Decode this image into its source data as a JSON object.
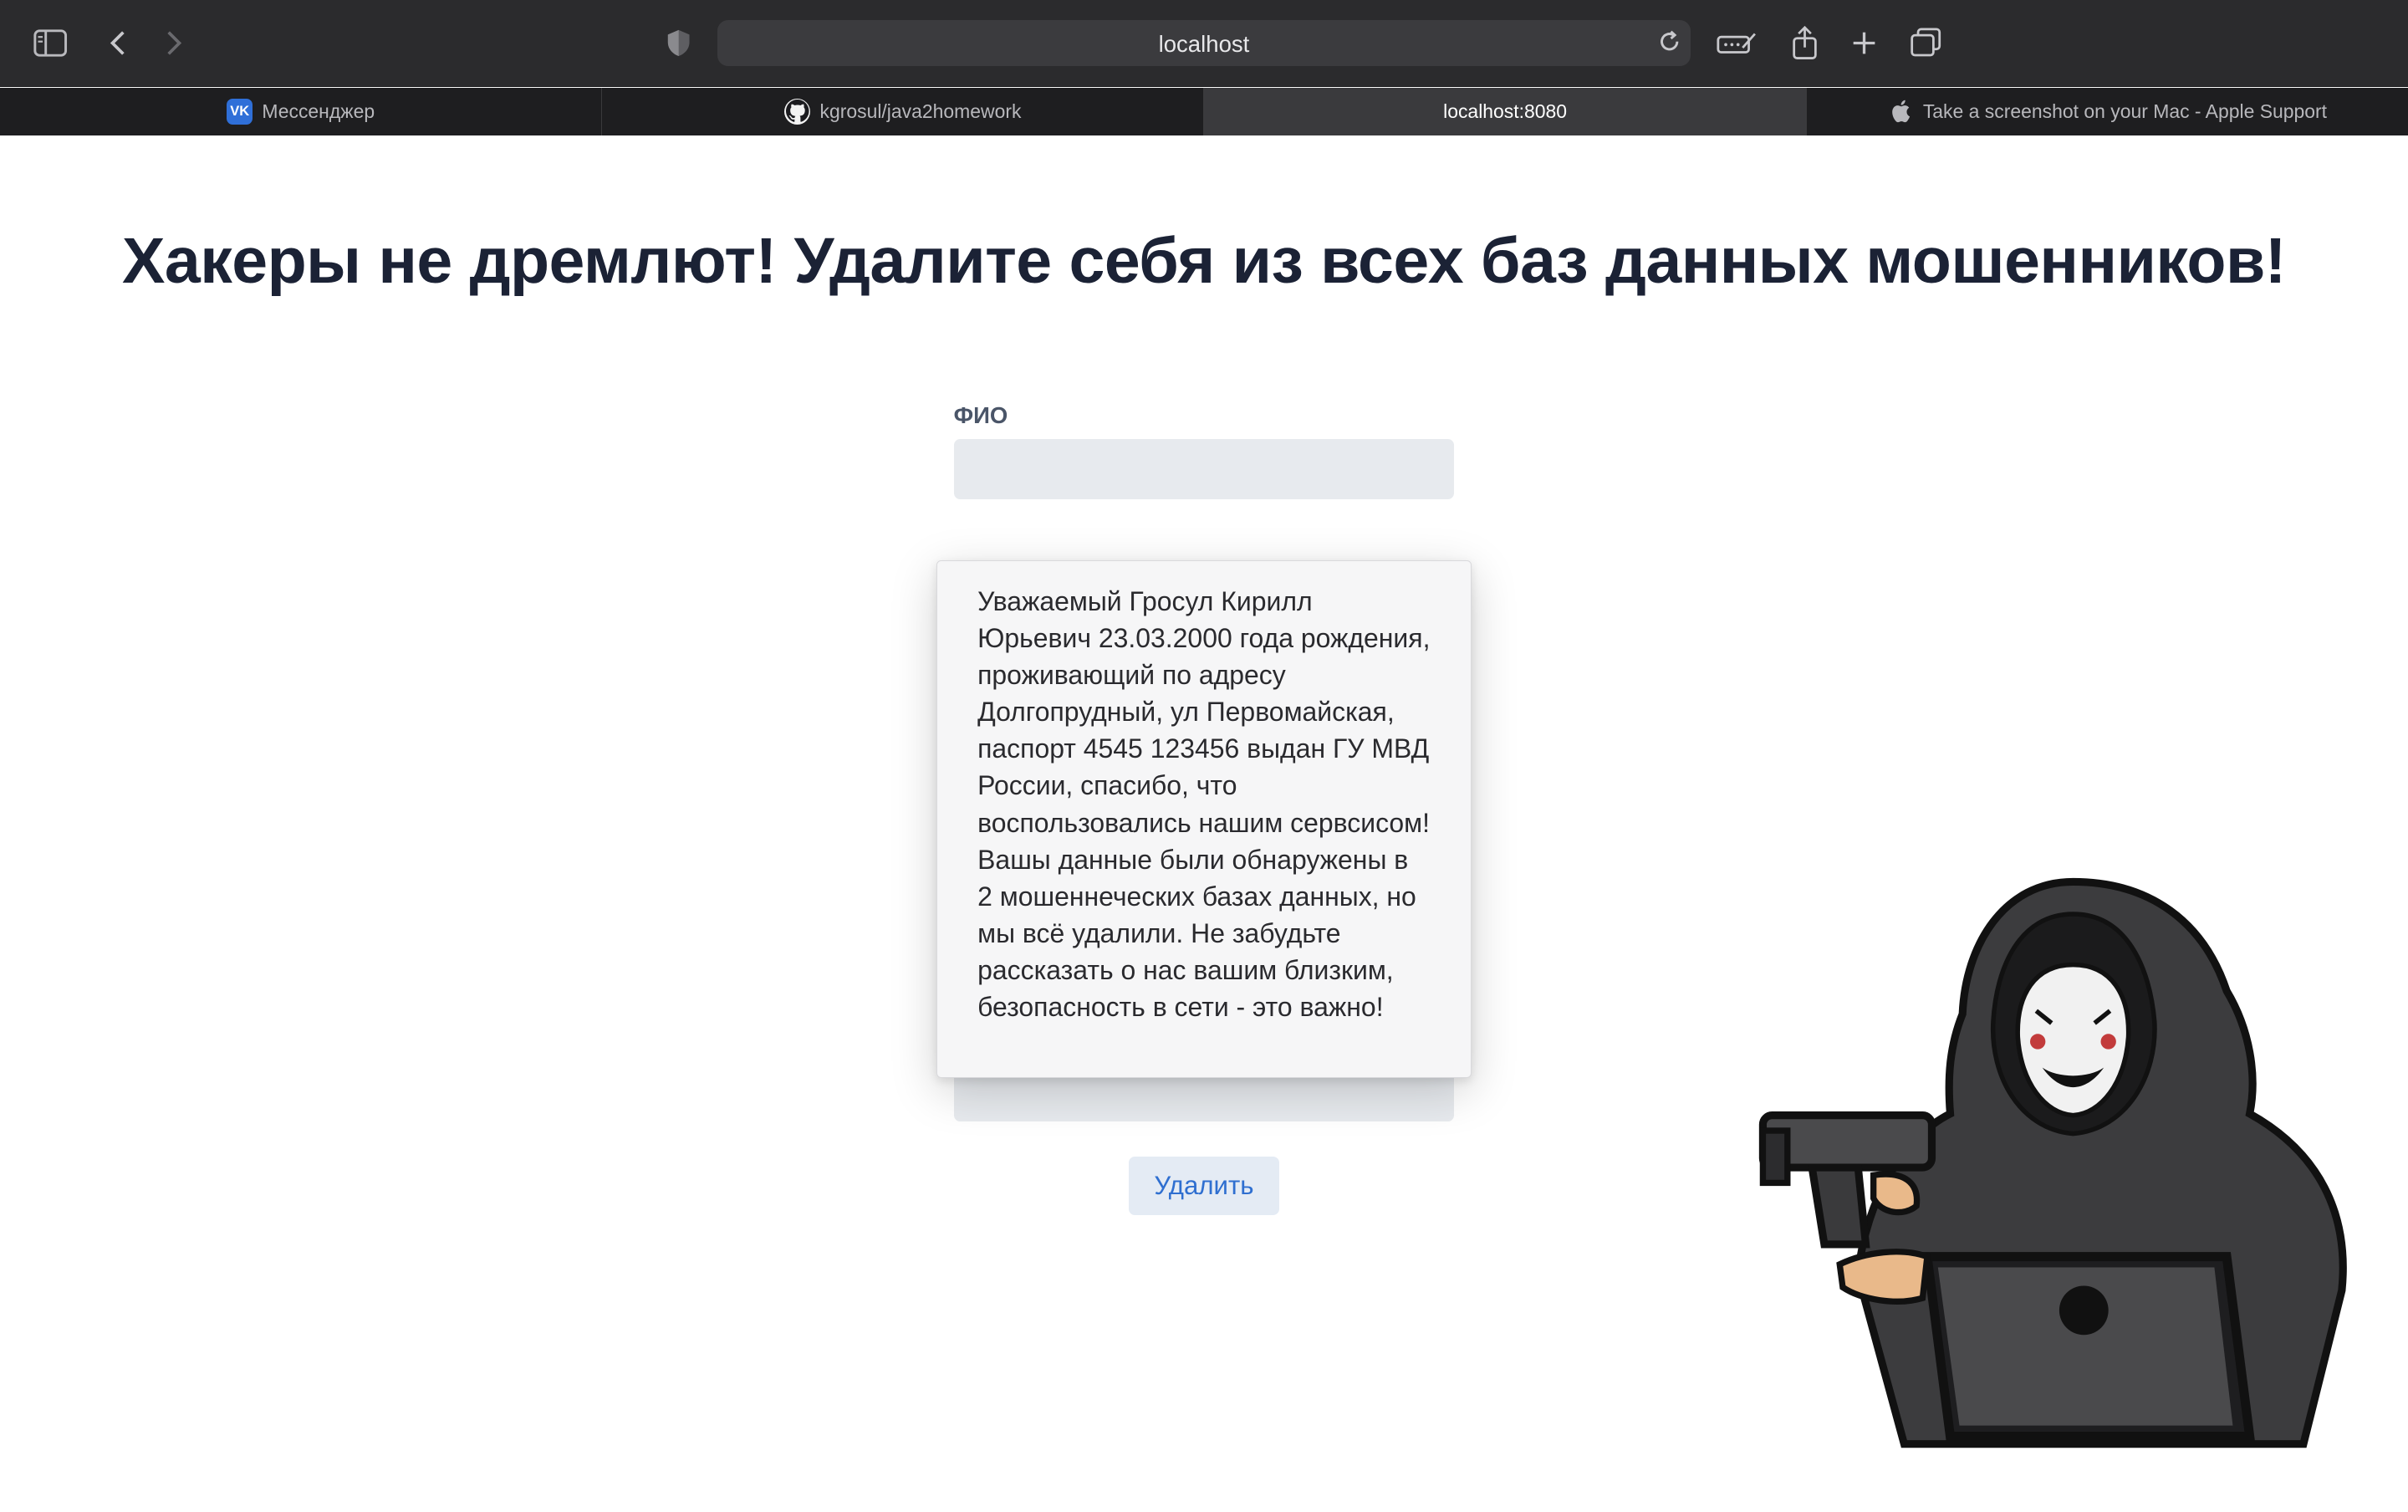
{
  "browser": {
    "address": "localhost",
    "tabs": [
      {
        "label": "Мессенджер",
        "icon": "vk-icon"
      },
      {
        "label": "kgrosul/java2homework",
        "icon": "github-icon"
      },
      {
        "label": "localhost:8080",
        "icon": "",
        "active": true
      },
      {
        "label": "Take a screenshot on your Mac - Apple Support",
        "icon": "apple-icon"
      }
    ]
  },
  "page": {
    "headline": "Хакеры не дремлют! Удалите себя из всех баз данных мошенников!",
    "field_label": "ФИО",
    "popup_message": "Уважаемый Гросул Кирилл Юрьевич 23.03.2000 года рождения, проживающий по адресу Долгопрудный, ул Первомайская, паспорт 4545 123456 выдан ГУ МВД России, спасибо, что воспользовались нашим сервсисом! Вашы данные были обнаружены в 2 мошеннеческих базах данных, но мы всё удалили. Не забудьте рассказать о нас вашим близким, безопасность в сети - это важно!",
    "delete_button": "Удалить"
  },
  "colors": {
    "headline": "#1b2235",
    "button_text": "#2f6fd0",
    "button_bg": "#e4ebf4",
    "input_bg": "#e7eaee"
  }
}
